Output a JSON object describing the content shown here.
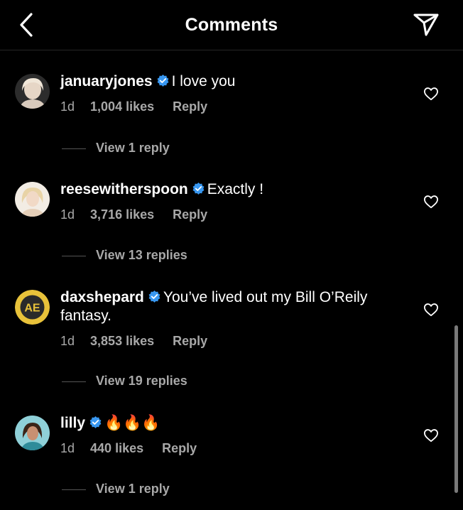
{
  "header": {
    "title": "Comments"
  },
  "comments": [
    {
      "username": "januaryjones",
      "text": "I love you",
      "time": "1d",
      "likes": "1,004 likes",
      "reply_label": "Reply",
      "view_replies": "View 1 reply"
    },
    {
      "username": "reesewitherspoon",
      "text": "Exactly !",
      "time": "1d",
      "likes": "3,716 likes",
      "reply_label": "Reply",
      "view_replies": "View 13 replies"
    },
    {
      "username": "daxshepard",
      "text": "You’ve lived out my Bill O’Reily fantasy.",
      "time": "1d",
      "likes": "3,853 likes",
      "reply_label": "Reply",
      "view_replies": "View 19 replies",
      "avatar_letters": "AE"
    },
    {
      "username": "lilly",
      "text": "🔥🔥🔥",
      "time": "1d",
      "likes": "440 likes",
      "reply_label": "Reply",
      "view_replies": "View 1 reply"
    }
  ],
  "colors": {
    "background": "#000000",
    "verified": "#3897f0",
    "secondary_text": "#a8a8a8",
    "dax_avatar": "#e8c23a"
  },
  "icons": {
    "back": "chevron-left-icon",
    "send": "paper-plane-icon",
    "like": "heart-outline-icon",
    "verified": "verified-badge-icon"
  }
}
